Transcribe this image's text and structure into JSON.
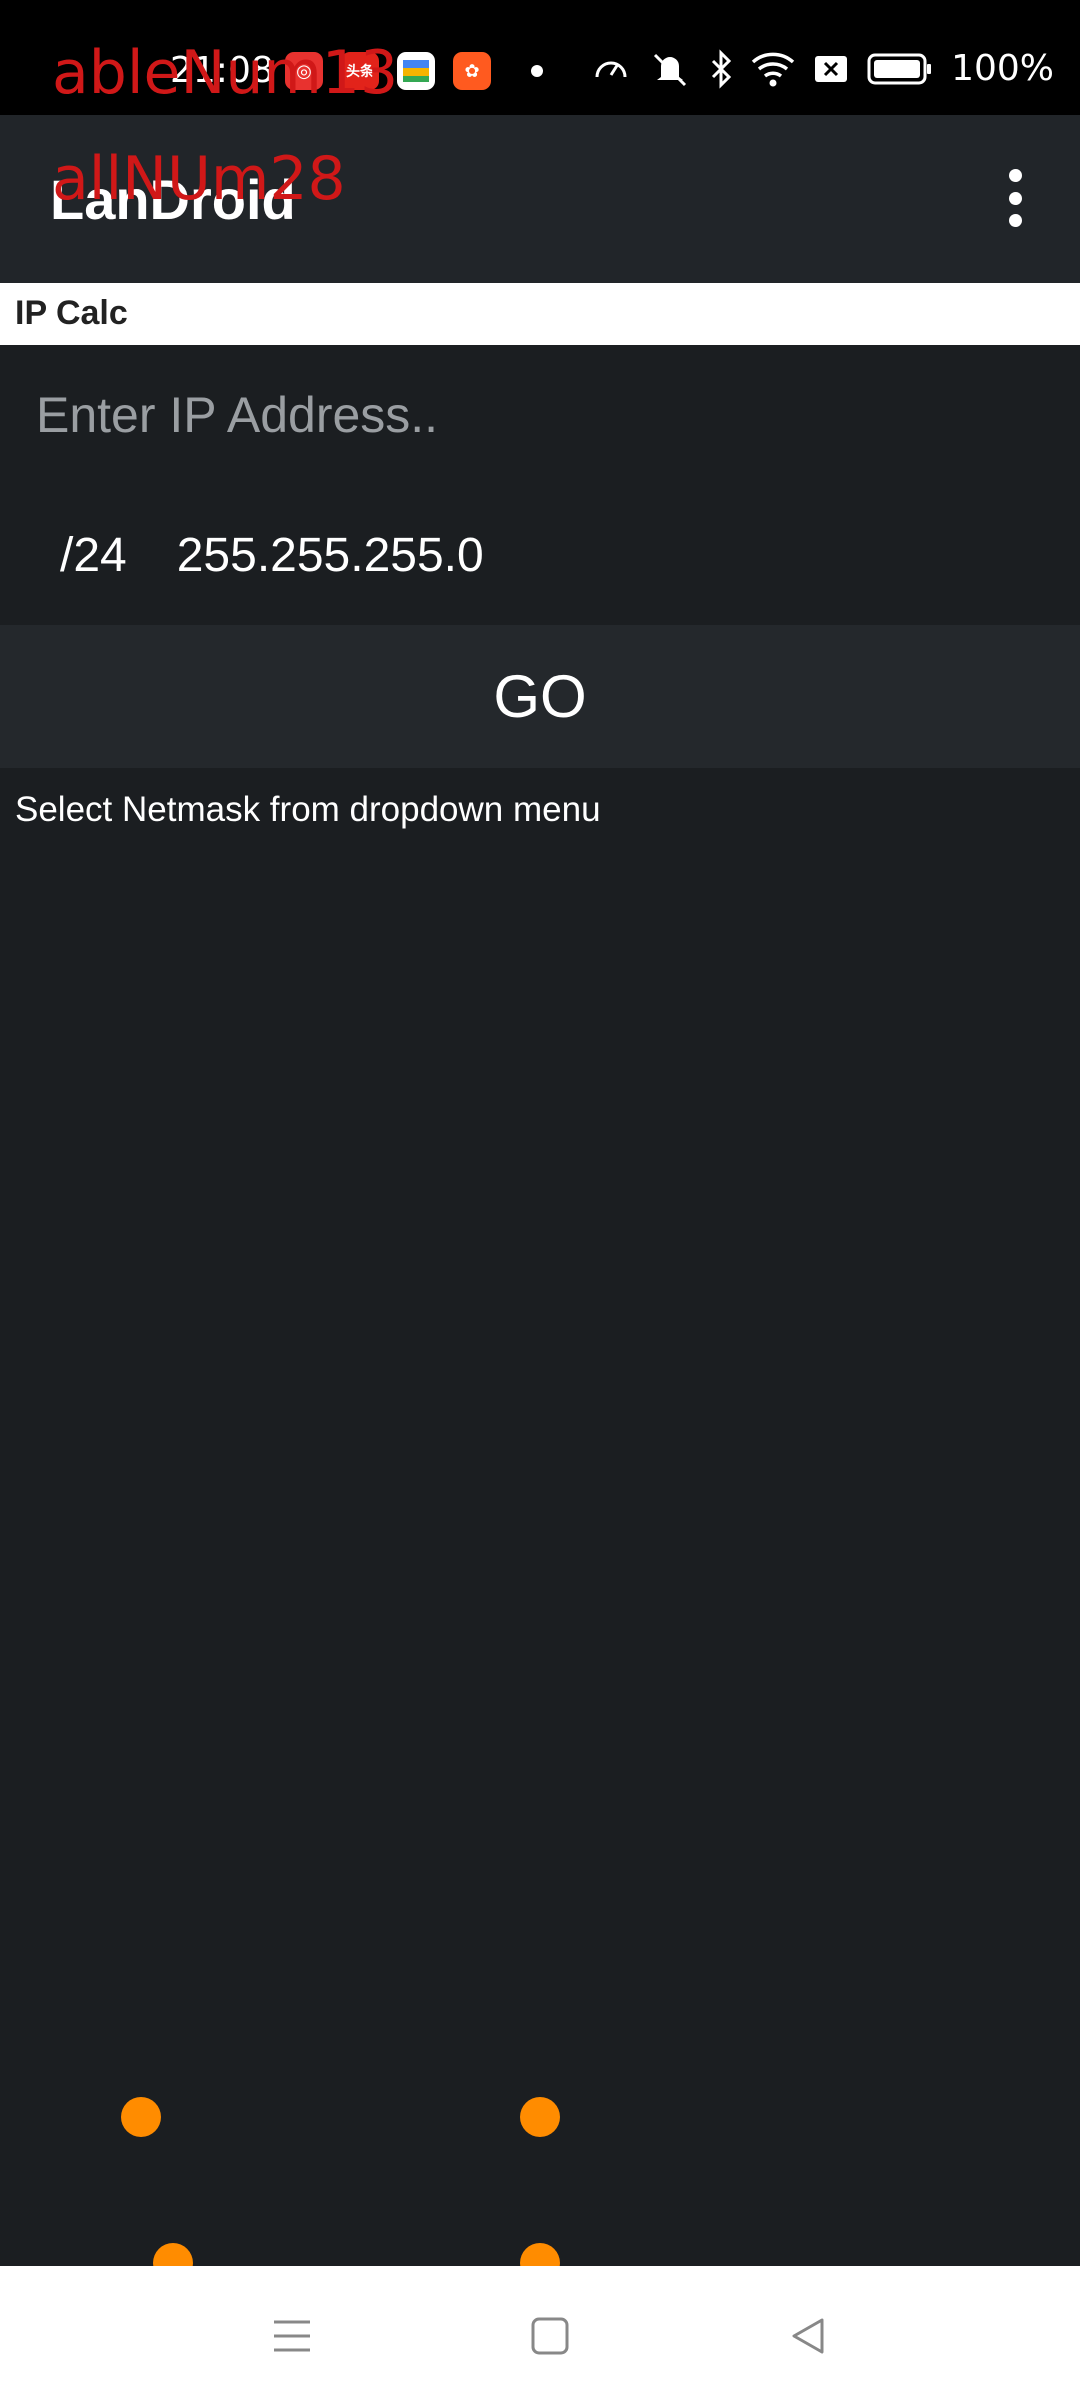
{
  "status_bar": {
    "time": "21:08",
    "battery": "100%",
    "notification_icons": [
      {
        "name": "netease-music-icon",
        "color": "#e8322f",
        "glyph": "◎"
      },
      {
        "name": "toutiao-icon",
        "color": "#e2231a",
        "glyph": "头条"
      },
      {
        "name": "maps-icon",
        "color": "#f5b400",
        "glyph": "▦"
      },
      {
        "name": "kuaishou-icon",
        "color": "#ff5a1f",
        "glyph": "✿"
      }
    ]
  },
  "overlay": {
    "line1": "ableNum13",
    "line2": "allNUm28"
  },
  "app_bar": {
    "title": "LanDroid"
  },
  "tab": {
    "label": "IP Calc"
  },
  "form": {
    "ip_placeholder": "Enter IP Address..",
    "ip_value": "",
    "netmask_cidr": "/24",
    "netmask_value": "255.255.255.0",
    "go_label": "GO",
    "hint": "Select Netmask from dropdown menu"
  },
  "colors": {
    "accent_touch": "#ff8c00",
    "background": "#1b1e21",
    "app_bar": "#212529"
  }
}
